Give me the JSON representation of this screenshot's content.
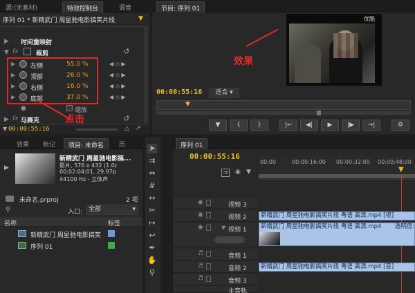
{
  "source_panel": {
    "tabs": [
      "源:(无素材)",
      "特效控制台",
      "调音"
    ],
    "sequence_label": "序列 01 * 新精武门 周星驰电影搞笑片段",
    "time_remap": "时间重映射",
    "crop_label": "裁剪",
    "crop_params": [
      {
        "name": "左侧",
        "value": "55.0 %"
      },
      {
        "name": "顶部",
        "value": "26.0 %"
      },
      {
        "name": "右侧",
        "value": "16.0 %"
      },
      {
        "name": "底部",
        "value": "37.0 %"
      }
    ],
    "scale_label": "缩放",
    "mosaic_label": "马赛克",
    "fx_label": "fx",
    "timecode": "00:00:55:16"
  },
  "program_panel": {
    "tab": "节目: 序列 01",
    "timecode": "00:00:55:16",
    "fit": "适合",
    "watermark": "优酷"
  },
  "annotations": {
    "effect": "效果",
    "click": "点击"
  },
  "project_panel": {
    "tabs": [
      "效果",
      "标记",
      "项目: 未命名",
      "历"
    ],
    "clip_title": "新精武门 周星驰电影搞...",
    "clip_info1": "影片, 576 x 432 (1.0)",
    "clip_info2": "00:02:04:01, 29.97p",
    "clip_info3": "44100 Hz - 立体声",
    "project_file": "未命名.prproj",
    "item_count": "2 项",
    "entry_label": "入口:",
    "entry_value": "全部",
    "col_name": "名称",
    "col_tag": "标签",
    "items": [
      {
        "name": "新精武门 周星驰电影搞笑",
        "color": "#6c9ad6"
      },
      {
        "name": "序列 01",
        "color": "#3eaa50"
      }
    ]
  },
  "timeline": {
    "tab": "序列 01",
    "timecode": "00:00:55:16",
    "ruler": [
      "00:00",
      "00:00:16:00",
      "00:00:32:00",
      "00:00:48:00"
    ],
    "tracks": {
      "video3": "视频 3",
      "video2": "视频 2",
      "video1": "视频 1",
      "audio1": "音频 1",
      "audio2": "音频 2",
      "audio3": "音频 3",
      "master": "主音轨"
    },
    "clip_v3": "新精武门 周星驰电影搞笑片段 粤语 高清.mp4 [视]",
    "clip_v1": "新精武门 周星驰电影搞笑片段 粤语 高清.mp4",
    "clip_v1_fx": "透明度:",
    "clip_a2": "新精武门 周星驰电影搞笑片段 粤语 高清.mp4 [音]"
  }
}
